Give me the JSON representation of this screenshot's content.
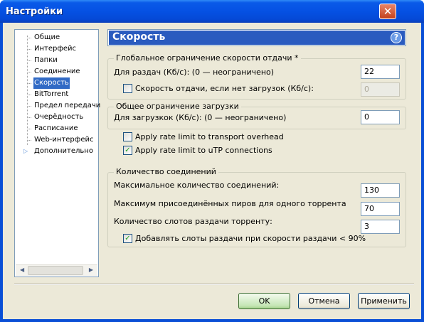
{
  "window": {
    "title": "Настройки",
    "close_glyph": "✕"
  },
  "tree": {
    "items": [
      {
        "label": "Общие",
        "selected": false
      },
      {
        "label": "Интерфейс",
        "selected": false
      },
      {
        "label": "Папки",
        "selected": false
      },
      {
        "label": "Соединение",
        "selected": false
      },
      {
        "label": "Скорость",
        "selected": true
      },
      {
        "label": "BitTorrent",
        "selected": false
      },
      {
        "label": "Предел передачи",
        "selected": false
      },
      {
        "label": "Очерёдность",
        "selected": false
      },
      {
        "label": "Расписание",
        "selected": false
      },
      {
        "label": "Web-интерфейс",
        "selected": false
      },
      {
        "label": "Дополнительно",
        "selected": false
      }
    ],
    "expand_glyph": "▷",
    "scroll_left": "◀",
    "scroll_right": "▶"
  },
  "header": {
    "title": "Скорость",
    "help_glyph": "?"
  },
  "upload": {
    "legend": "Глобальное ограничение скорости отдачи *",
    "limit_label": "Для раздач (Кб/с): (0 — неограничено)",
    "limit_value": "22",
    "alt_label": "Скорость отдачи, если нет загрузок (Кб/с):",
    "alt_value": "0",
    "alt_checked": false
  },
  "download": {
    "legend": "Общее ограничение загрузки",
    "limit_label": "Для загрузкок (Кб/с): (0 — неограничено)",
    "limit_value": "0"
  },
  "options": {
    "transport_label": "Apply rate limit to transport overhead",
    "transport_checked": false,
    "utp_label": "Apply rate limit to uTP connections",
    "utp_checked": true
  },
  "connections": {
    "legend": "Количество соединений",
    "max_label": "Максимальное количество соединений:",
    "max_value": "130",
    "peers_label": "Максимум присоединённых пиров для одного торрента",
    "peers_value": "70",
    "slots_label": "Количество слотов раздачи торренту:",
    "slots_value": "3",
    "extra_label": "Добавлять слоты раздачи при скорости раздачи < 90%",
    "extra_checked": true
  },
  "buttons": {
    "ok": "OK",
    "cancel": "Отмена",
    "apply": "Применить"
  },
  "check_glyph": "✓"
}
